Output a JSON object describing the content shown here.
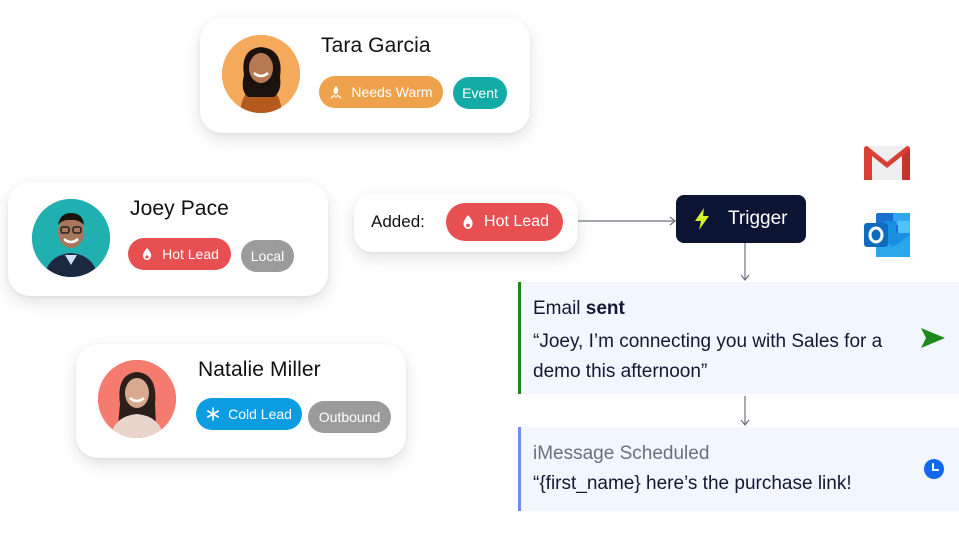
{
  "contacts": [
    {
      "name": "Tara Garcia",
      "avatar_bg": "#f5a95a",
      "tags": [
        {
          "label": "Needs Warm",
          "icon": "campfire-icon",
          "color": "#eda24b"
        },
        {
          "label": "Event",
          "color": "#12aba5"
        }
      ]
    },
    {
      "name": "Joey Pace",
      "avatar_bg": "#21b0b0",
      "tags": [
        {
          "label": "Hot Lead",
          "icon": "flame-icon",
          "color": "#e84f51"
        },
        {
          "label": "Local",
          "color": "#9b9b9b"
        }
      ]
    },
    {
      "name": "Natalie Miller",
      "avatar_bg": "#f47b6d",
      "tags": [
        {
          "label": "Cold Lead",
          "icon": "snowflake-icon",
          "color": "#0b9de0"
        },
        {
          "label": "Outbound",
          "color": "#9b9b9b"
        }
      ]
    }
  ],
  "added": {
    "label": "Added:",
    "tag": {
      "label": "Hot Lead",
      "icon": "flame-icon",
      "color": "#e84f51"
    }
  },
  "trigger": {
    "label": "Trigger",
    "icon": "lightning-bolt-icon",
    "bg": "#0b1433",
    "icon_color": "#d4f32a"
  },
  "integrations": [
    "gmail-icon",
    "outlook-icon"
  ],
  "actions": {
    "email": {
      "title_prefix": "Email",
      "title_bold": "sent",
      "body": "“Joey, I’m connecting you with Sales for a demo this afternoon”",
      "status_icon": "send-arrow-icon",
      "accent": "#1a8a1a"
    },
    "imessage": {
      "title": "iMessage Scheduled",
      "body": "“{first_name} here’s the purchase link!",
      "status_icon": "clock-icon",
      "accent": "#6b8cf2"
    }
  }
}
